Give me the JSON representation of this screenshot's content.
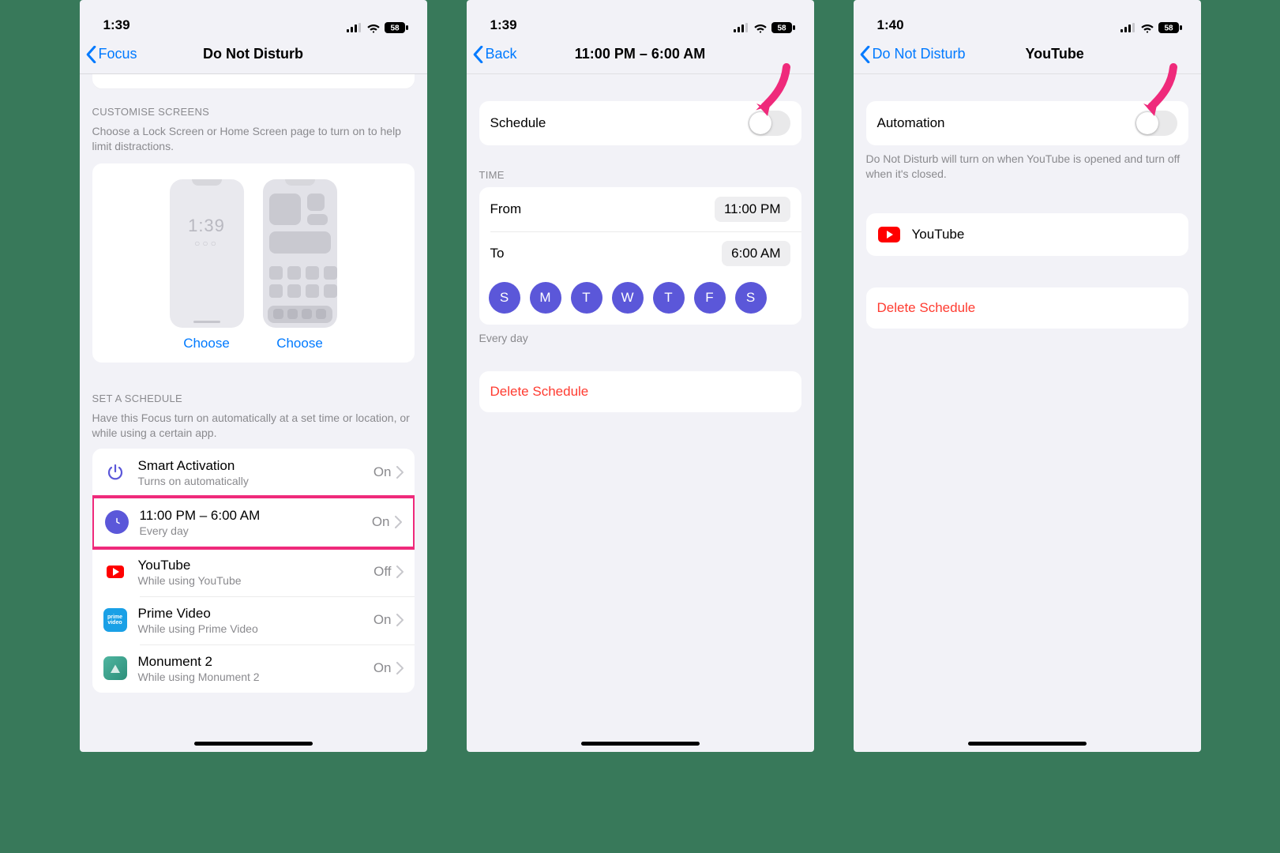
{
  "screens": [
    {
      "status_time": "1:39",
      "battery": "58",
      "back_label": "Focus",
      "title": "Do Not Disturb",
      "customise": {
        "header": "CUSTOMISE SCREENS",
        "desc": "Choose a Lock Screen or Home Screen page to turn on to help limit distractions.",
        "lock_time": "1:39",
        "choose": "Choose"
      },
      "schedule_section": {
        "header": "SET A SCHEDULE",
        "desc": "Have this Focus turn on automatically at a set time or location, or while using a certain app.",
        "rows": [
          {
            "title": "Smart Activation",
            "sub": "Turns on automatically",
            "value": "On",
            "icon": "power"
          },
          {
            "title": "11:00 PM – 6:00 AM",
            "sub": "Every day",
            "value": "On",
            "icon": "clock",
            "highlight": true
          },
          {
            "title": "YouTube",
            "sub": "While using YouTube",
            "value": "Off",
            "icon": "youtube"
          },
          {
            "title": "Prime Video",
            "sub": "While using Prime Video",
            "value": "On",
            "icon": "prime"
          },
          {
            "title": "Monument 2",
            "sub": "While using Monument 2",
            "value": "On",
            "icon": "monument"
          }
        ]
      }
    },
    {
      "status_time": "1:39",
      "battery": "58",
      "back_label": "Back",
      "title": "11:00 PM – 6:00 AM",
      "schedule_toggle_label": "Schedule",
      "time_header": "TIME",
      "from_label": "From",
      "from_value": "11:00 PM",
      "to_label": "To",
      "to_value": "6:00 AM",
      "days": [
        "S",
        "M",
        "T",
        "W",
        "T",
        "F",
        "S"
      ],
      "days_caption": "Every day",
      "delete_label": "Delete Schedule"
    },
    {
      "status_time": "1:40",
      "battery": "58",
      "back_label": "Do Not Disturb",
      "title": "YouTube",
      "automation_label": "Automation",
      "automation_desc": "Do Not Disturb will turn on when YouTube is opened and turn off when it's closed.",
      "app_label": "YouTube",
      "delete_label": "Delete Schedule"
    }
  ]
}
